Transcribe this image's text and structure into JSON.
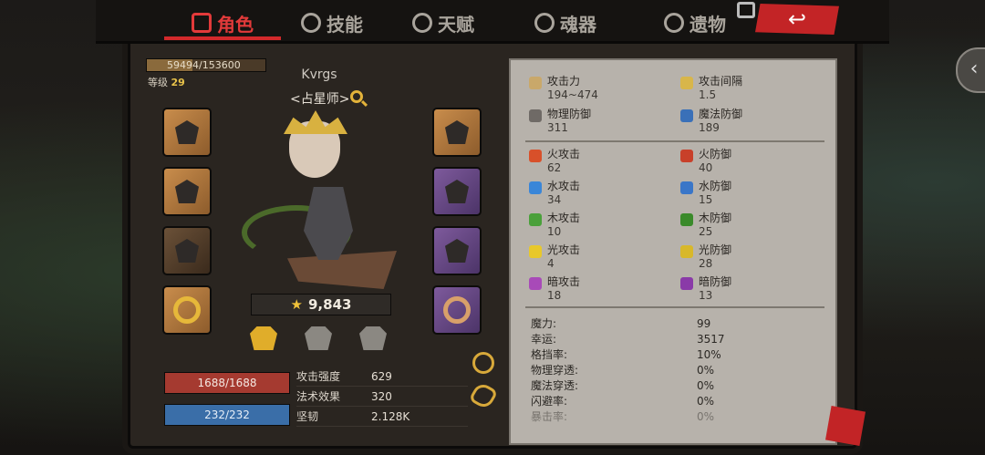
{
  "tabs": [
    {
      "label": "角色",
      "active": true
    },
    {
      "label": "技能",
      "active": false
    },
    {
      "label": "天赋",
      "active": false
    },
    {
      "label": "魂器",
      "active": false
    },
    {
      "label": "遗物",
      "active": false
    }
  ],
  "back_icon": "↩",
  "character": {
    "xp": "59494/153600",
    "xp_fraction": 0.387,
    "level_label": "等级",
    "level": "29",
    "name": "Kvrgs",
    "class": "<占星师>",
    "power": "9,843"
  },
  "vitals": {
    "hp": "1688/1688",
    "mp": "232/232"
  },
  "substats": [
    {
      "label": "攻击强度",
      "value": "629"
    },
    {
      "label": "法术效果",
      "value": "320"
    },
    {
      "label": "坚韧",
      "value": "2.128K"
    }
  ],
  "stats_top": [
    {
      "label": "攻击力",
      "value": "194~474",
      "color": "#c9a86a"
    },
    {
      "label": "攻击间隔",
      "value": "1.5",
      "color": "#d8b64a"
    },
    {
      "label": "物理防御",
      "value": "311",
      "color": "#6f6a66"
    },
    {
      "label": "魔法防御",
      "value": "189",
      "color": "#3a70b8"
    }
  ],
  "stats_elements": [
    {
      "label": "火攻击",
      "value": "62",
      "color": "#d8502a"
    },
    {
      "label": "火防御",
      "value": "40",
      "color": "#c8402a"
    },
    {
      "label": "水攻击",
      "value": "34",
      "color": "#3a86d8"
    },
    {
      "label": "水防御",
      "value": "15",
      "color": "#3a76c8"
    },
    {
      "label": "木攻击",
      "value": "10",
      "color": "#4aa03a"
    },
    {
      "label": "木防御",
      "value": "25",
      "color": "#3a8a2a"
    },
    {
      "label": "光攻击",
      "value": "4",
      "color": "#e8c82a"
    },
    {
      "label": "光防御",
      "value": "28",
      "color": "#d8b82a"
    },
    {
      "label": "暗攻击",
      "value": "18",
      "color": "#a84ab8"
    },
    {
      "label": "暗防御",
      "value": "13",
      "color": "#8a3aa8"
    }
  ],
  "stats_misc": [
    {
      "label": "魔力:",
      "value": "99"
    },
    {
      "label": "幸运:",
      "value": "3517"
    },
    {
      "label": "格挡率:",
      "value": "10%"
    },
    {
      "label": "物理穿透:",
      "value": "0%"
    },
    {
      "label": "魔法穿透:",
      "value": "0%"
    },
    {
      "label": "闪避率:",
      "value": "0%"
    },
    {
      "label": "暴击率:",
      "value": "0%"
    }
  ]
}
